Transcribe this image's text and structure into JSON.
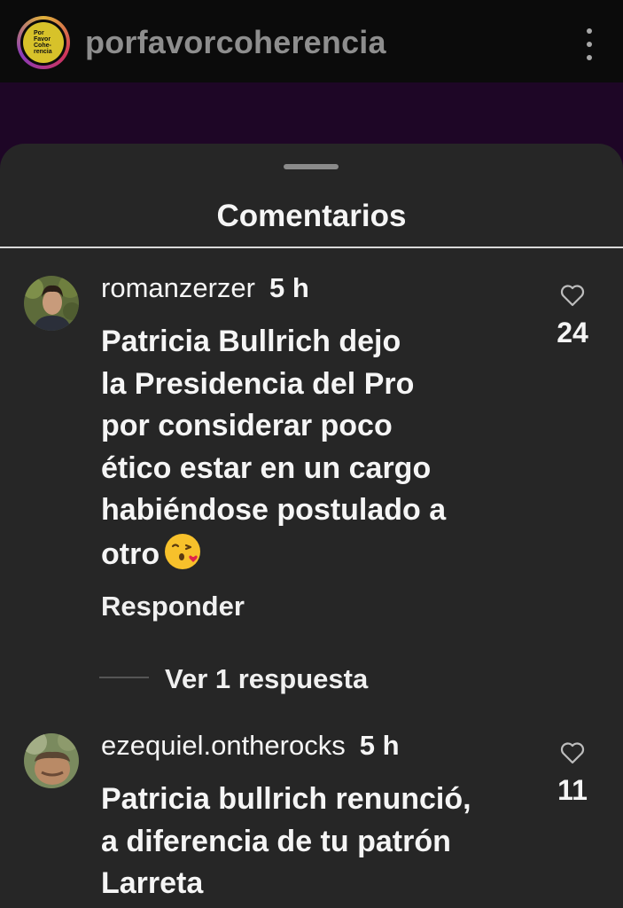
{
  "header": {
    "account_name": "porfavorcoherencia",
    "logo_text": [
      "Por",
      "Favor",
      "Cohe-",
      "rencia"
    ]
  },
  "sheet": {
    "title": "Comentarios"
  },
  "comments": [
    {
      "username": "romanzerzer",
      "time": "5 h",
      "text_lines": [
        "Patricia Bullrich dejo",
        "la Presidencia del Pro",
        "por considerar poco",
        "ético estar en un cargo",
        "habiéndose postulado a",
        "otro"
      ],
      "emoji": "kissing-heart-emoji",
      "likes": "24",
      "reply_label": "Responder",
      "view_replies_label": "Ver 1 respuesta"
    },
    {
      "username": "ezequiel.ontherocks",
      "time": "5 h",
      "text_lines": [
        "Patricia bullrich renunció,",
        "a diferencia de tu patrón",
        "Larreta"
      ],
      "likes": "11"
    }
  ],
  "colors": {
    "background": "#262626",
    "topbar": "#0b0b0b",
    "purple_strip": "#1e0626",
    "logo_yellow": "#d7c22a"
  }
}
